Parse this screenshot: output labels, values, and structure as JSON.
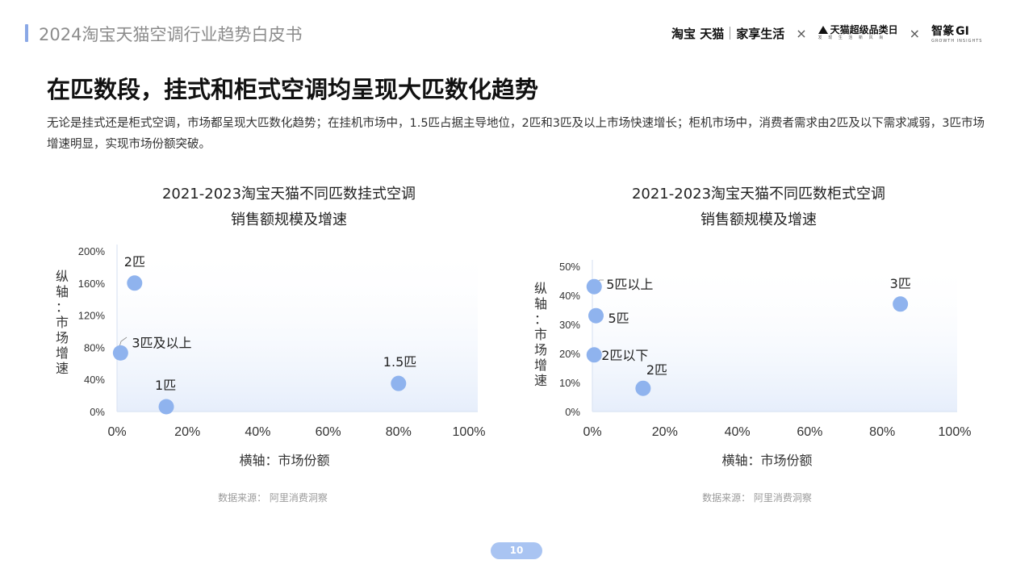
{
  "header": {
    "title": "2024淘宝天猫空调行业趋势白皮书",
    "brands": {
      "taobao_tmall": "淘宝 天猫",
      "jiaxiang": "家享生活",
      "cross": "×",
      "super_day": "天猫超级品类日",
      "super_day_sub": "发 现 生 活 新 风 尚",
      "zhiju": "智篆",
      "gi": "GI",
      "gi_sub": "GROWTH INSIGHTS"
    }
  },
  "page_title": "在匹数段，挂式和柜式空调均呈现大匹数化趋势",
  "description": "无论是挂式还是柜式空调，市场都呈现大匹数化趋势；在挂机市场中，1.5匹占据主导地位，2匹和3匹及以上市场快速增长；柜机市场中，消费者需求由2匹及以下需求减弱，3匹市场增速明显，实现市场份额突破。",
  "colors": {
    "point": "#8fb3ee",
    "accent": "#8aa8e6",
    "plot_bg_top": "#ffffff",
    "plot_bg_bottom": "#e6eefb"
  },
  "charts": [
    {
      "title_line1": "2021-2023淘宝天猫不同匹数挂式空调",
      "title_line2": "销售额规模及增速",
      "ylabel": "纵轴：市场增速",
      "xlabel": "横轴：市场份额",
      "source": "数据来源：  阿里消费洞察"
    },
    {
      "title_line1": "2021-2023淘宝天猫不同匹数柜式空调",
      "title_line2": "销售额规模及增速",
      "ylabel": "纵轴：市场增速",
      "xlabel": "横轴：市场份额",
      "source": "数据来源：  阿里消费洞察"
    }
  ],
  "chart_data": [
    {
      "type": "scatter",
      "title": "2021-2023淘宝天猫不同匹数挂式空调销售额规模及增速",
      "xlabel": "横轴：市场份额",
      "ylabel": "纵轴：市场增速",
      "xlim": [
        0,
        100
      ],
      "ylim": [
        0,
        200
      ],
      "xticks": [
        "0%",
        "20%",
        "40%",
        "60%",
        "80%",
        "100%"
      ],
      "yticks": [
        "0%",
        "40%",
        "80%",
        "120%",
        "160%",
        "200%"
      ],
      "points": [
        {
          "label": "2匹",
          "x": 5,
          "y": 160
        },
        {
          "label": "3匹及以上",
          "x": 1,
          "y": 73
        },
        {
          "label": "1匹",
          "x": 14,
          "y": 6
        },
        {
          "label": "1.5匹",
          "x": 80,
          "y": 35
        }
      ]
    },
    {
      "type": "scatter",
      "title": "2021-2023淘宝天猫不同匹数柜式空调销售额规模及增速",
      "xlabel": "横轴：市场份额",
      "ylabel": "纵轴：市场增速",
      "xlim": [
        0,
        100
      ],
      "ylim": [
        0,
        50
      ],
      "xticks": [
        "0%",
        "20%",
        "40%",
        "60%",
        "80%",
        "100%"
      ],
      "yticks": [
        "0%",
        "10%",
        "20%",
        "30%",
        "40%",
        "50%"
      ],
      "points": [
        {
          "label": "5匹以上",
          "x": 0.5,
          "y": 43
        },
        {
          "label": "5匹",
          "x": 1,
          "y": 33
        },
        {
          "label": "2匹以下",
          "x": 0.5,
          "y": 19.5
        },
        {
          "label": "2匹",
          "x": 14,
          "y": 8
        },
        {
          "label": "3匹",
          "x": 85,
          "y": 37
        }
      ]
    }
  ],
  "page_number": "10"
}
